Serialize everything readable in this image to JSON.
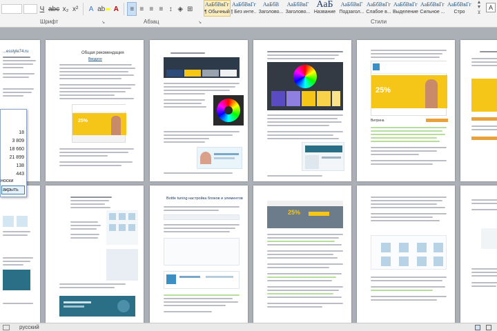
{
  "ribbon": {
    "font_group_label": "Шрифт",
    "paragraph_group_label": "Абзац",
    "styles_group_label": "Стили",
    "styles": [
      {
        "sample": "АаБбВвГг",
        "name": "¶ Обычный",
        "active": true
      },
      {
        "sample": "АаБбВвГг",
        "name": "¶ Без инте...",
        "active": false
      },
      {
        "sample": "АаБбВ",
        "name": "Заголово...",
        "active": false
      },
      {
        "sample": "АаБбВвГ",
        "name": "Заголово...",
        "active": false
      },
      {
        "sample": "АаБ",
        "name": "Название",
        "active": false
      },
      {
        "sample": "АаБбВвГ",
        "name": "Подзагол...",
        "active": false
      },
      {
        "sample": "АаБбВвГг",
        "name": "Слабое в...",
        "active": false
      },
      {
        "sample": "АаБбВвГг",
        "name": "Выделение",
        "active": false
      },
      {
        "sample": "АаБбВвГг",
        "name": "Сильное ...",
        "active": false
      },
      {
        "sample": "АаБбВвГг",
        "name": "Стро",
        "active": false
      }
    ]
  },
  "pages": {
    "p1_site": "...esstyle74.ru",
    "p2_title": "Общая рекомендация",
    "p2_subtitle": "Вводное",
    "p5_badge": "25%",
    "p6_title": "Витрина",
    "p8_title": "Bottle tuning настройка блоков и элементов"
  },
  "stats_dialog": {
    "values": [
      "18",
      "3 809",
      "18 660",
      "21 899",
      "138",
      "443"
    ],
    "footnote_label": "носки",
    "close_button": "акрыть"
  },
  "status": {
    "language": "русский"
  },
  "colors": {
    "accent_yellow": "#f5c518",
    "accent_orange": "#e9a23b",
    "dark_navy": "#2d3a4a",
    "teal": "#2a6f86"
  }
}
